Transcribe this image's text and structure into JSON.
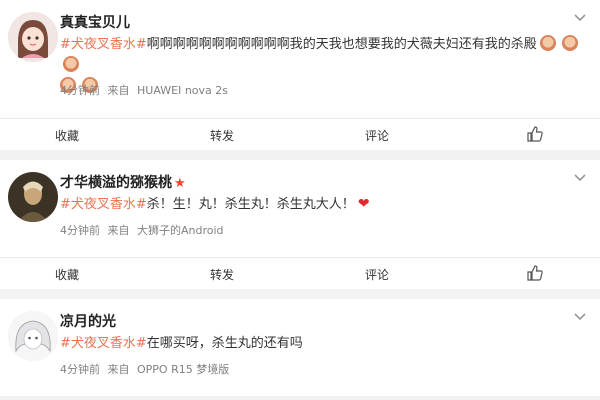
{
  "posts": [
    {
      "username": "真真宝贝儿",
      "topic": "#犬夜叉香水#",
      "text": "啊啊啊啊啊啊啊啊啊啊啊我的天我也想要我的犬薇夫妇还有我的杀殿",
      "time": "4分钟前",
      "source_prefix": "来自",
      "source": "HUAWEI nova 2s",
      "emoji_count": 5,
      "verified_star": false,
      "heart": false
    },
    {
      "username": "才华横溢的猕猴桃",
      "topic": "#犬夜叉香水#",
      "text": "杀！生！丸！杀生丸！杀生丸大人！",
      "time": "4分钟前",
      "source_prefix": "来自",
      "source": "大狮子的Android",
      "emoji_count": 0,
      "verified_star": true,
      "heart": true
    },
    {
      "username": "凉月的光",
      "topic": "#犬夜叉香水#",
      "text": "在哪买呀，杀生丸的还有吗",
      "time": "4分钟前",
      "source_prefix": "来自",
      "source": "OPPO R15 梦境版",
      "emoji_count": 0,
      "verified_star": false,
      "heart": false
    }
  ],
  "actions": {
    "favorite": "收藏",
    "repost": "转发",
    "comment": "评论"
  },
  "icons": {
    "dropdown": "chevron-down-icon",
    "like": "thumbs-up-icon",
    "star": "star-icon",
    "heart": "heart-icon"
  },
  "colors": {
    "topic": "#eb7350",
    "meta": "#808080",
    "background": "#f2f2f2"
  }
}
